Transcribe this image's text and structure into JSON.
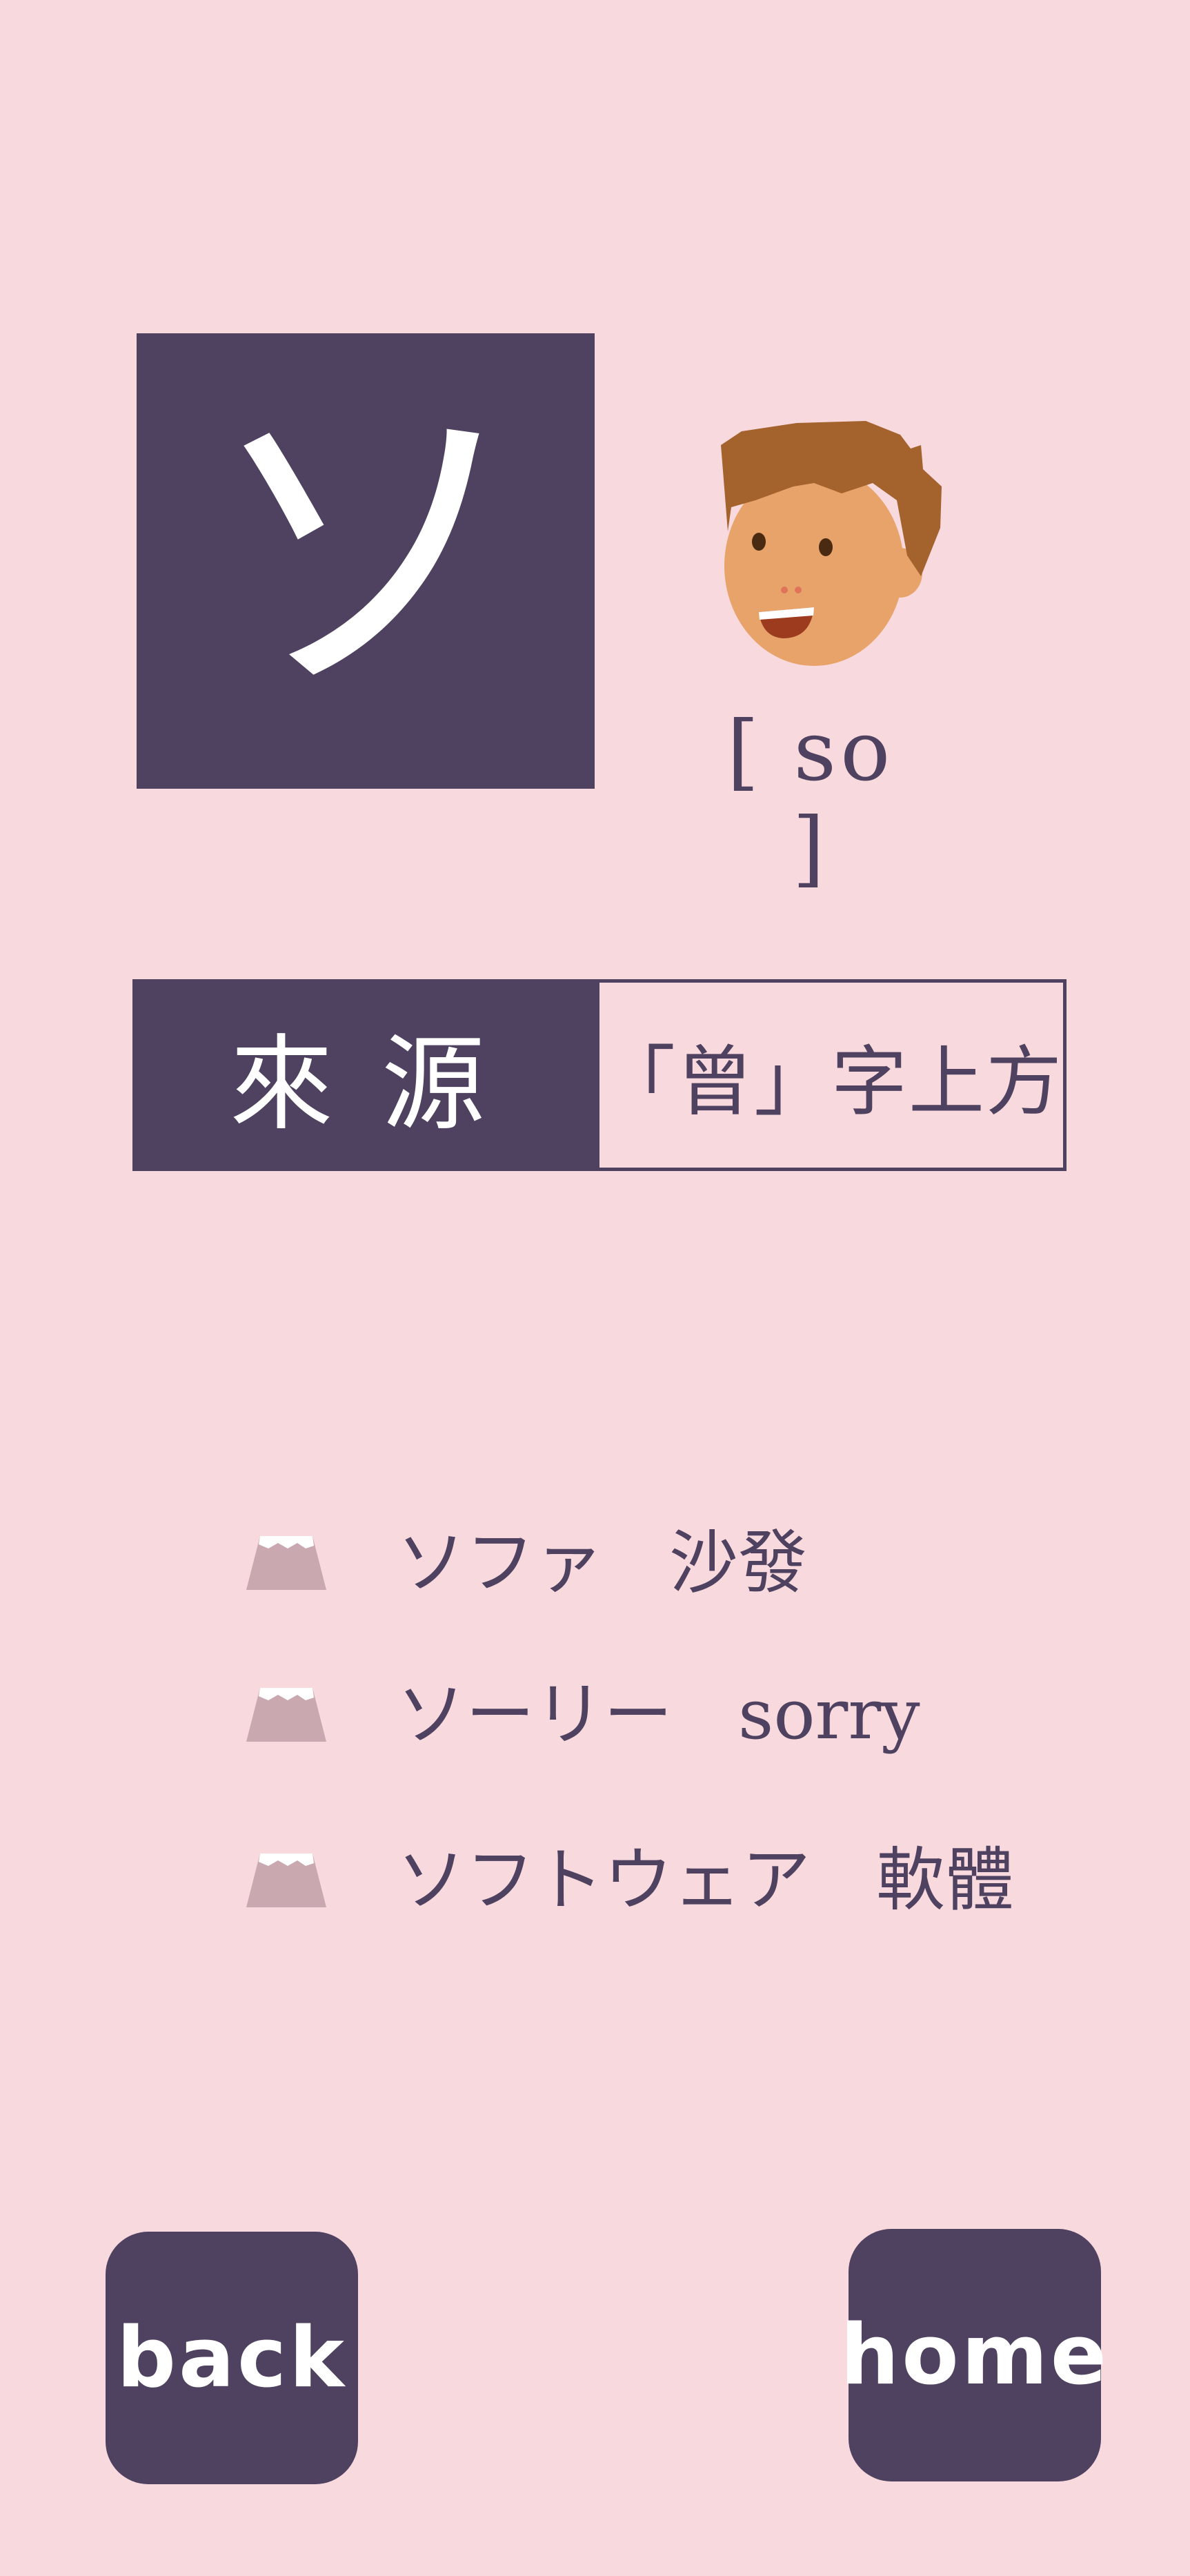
{
  "kana": {
    "character": "ソ",
    "romaji": "[ so ]"
  },
  "origin": {
    "label": "來源",
    "value": "「曾」字上方"
  },
  "vocabulary": [
    {
      "word": "ソファ",
      "meaning": "沙發",
      "icon": "mount-fuji-icon"
    },
    {
      "word": "ソーリー",
      "meaning": "sorry",
      "icon": "mount-fuji-icon"
    },
    {
      "word": "ソフトウェア",
      "meaning": "軟體",
      "icon": "mount-fuji-icon"
    }
  ],
  "nav": {
    "back_label": "back",
    "home_label": "home"
  },
  "colors": {
    "background": "#f8d9de",
    "accent": "#4f4260",
    "fuji": "#c9a8b0"
  }
}
